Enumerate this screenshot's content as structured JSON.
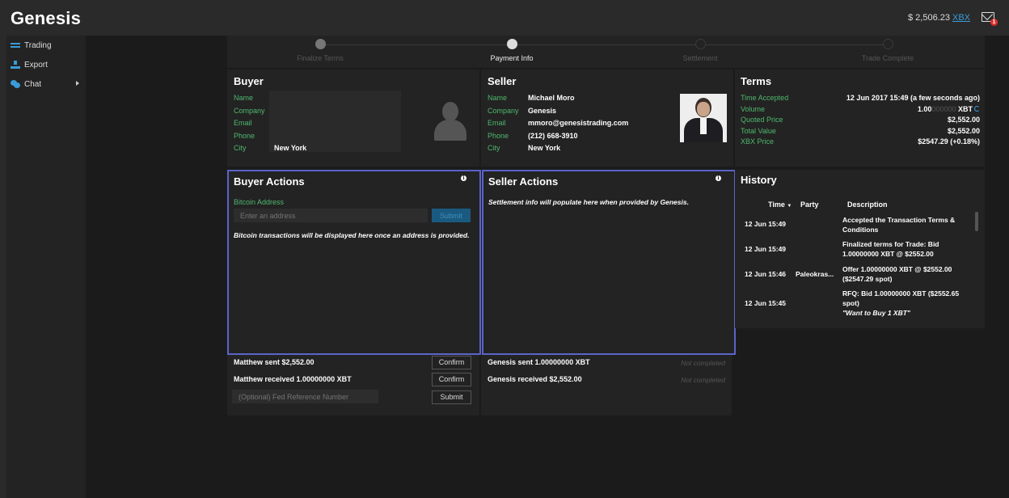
{
  "app": {
    "logo": "Genesis",
    "balance": "$ 2,506.23",
    "balance_currency": "XBX",
    "mail_badge": "1"
  },
  "sidebar": {
    "items": [
      {
        "label": "Trading",
        "icon": "trading-icon"
      },
      {
        "label": "Export",
        "icon": "export-icon"
      },
      {
        "label": "Chat",
        "icon": "chat-icon"
      }
    ]
  },
  "progress": {
    "steps": [
      {
        "label": "Finalize Terms",
        "state": "done"
      },
      {
        "label": "Payment Info",
        "state": "active"
      },
      {
        "label": "Settlement",
        "state": "pending"
      },
      {
        "label": "Trade Complete",
        "state": "pending"
      }
    ]
  },
  "buyer": {
    "title": "Buyer",
    "labels": {
      "name": "Name",
      "company": "Company",
      "email": "Email",
      "phone": "Phone",
      "city": "City"
    },
    "city": "New York"
  },
  "seller": {
    "title": "Seller",
    "labels": {
      "name": "Name",
      "company": "Company",
      "email": "Email",
      "phone": "Phone",
      "city": "City"
    },
    "name": "Michael Moro",
    "company": "Genesis",
    "email": "mmoro@genesistrading.com",
    "phone": "(212) 668-3910",
    "city": "New York"
  },
  "terms": {
    "title": "Terms",
    "rows": {
      "time_label": "Time Accepted",
      "time_value": "12 Jun 2017 15:49 (a few seconds ago)",
      "volume_label": "Volume",
      "volume_value_main": "1.00",
      "volume_value_dim": "000000",
      "volume_unit": "XBT",
      "quoted_label": "Quoted Price",
      "quoted_value": "$2,552.00",
      "total_label": "Total Value",
      "total_value": "$2,552.00",
      "xbx_label": "XBX Price",
      "xbx_value": "$2547.29 (+0.18%)"
    }
  },
  "buyer_actions": {
    "title": "Buyer Actions",
    "address_label": "Bitcoin Address",
    "address_placeholder": "Enter an address",
    "submit_label": "Submit",
    "note": "Bitcoin transactions will be displayed here once an address is provided."
  },
  "seller_actions": {
    "title": "Seller Actions",
    "note": "Settlement info will populate here when provided by Genesis."
  },
  "buyer_tx": {
    "sent": "Matthew sent $2,552.00",
    "received": "Matthew received 1.00000000 XBT",
    "confirm_label": "Confirm",
    "ref_placeholder": "(Optional) Fed Reference Number",
    "submit_label": "Submit"
  },
  "seller_tx": {
    "sent": "Genesis sent 1.00000000 XBT",
    "received": "Genesis received $2,552.00",
    "status": "Not completed"
  },
  "history": {
    "title": "History",
    "columns": {
      "time": "Time",
      "sort_indicator": "▼",
      "party": "Party",
      "description": "Description"
    },
    "rows": [
      {
        "time": "12 Jun 15:49",
        "party": "",
        "description": "Accepted the Transaction Terms & Conditions",
        "note": ""
      },
      {
        "time": "12 Jun 15:49",
        "party": "",
        "description": "Finalized terms for Trade: Bid 1.00000000 XBT @ $2552.00",
        "note": ""
      },
      {
        "time": "12 Jun 15:46",
        "party": "Paleokras...",
        "description": "Offer 1.00000000 XBT @ $2552.00 ($2547.29 spot)",
        "note": ""
      },
      {
        "time": "12 Jun 15:45",
        "party": "",
        "description": "RFQ: Bid 1.00000000 XBT ($2552.65 spot)",
        "note": "\"Want to Buy 1 XBT\""
      }
    ]
  }
}
